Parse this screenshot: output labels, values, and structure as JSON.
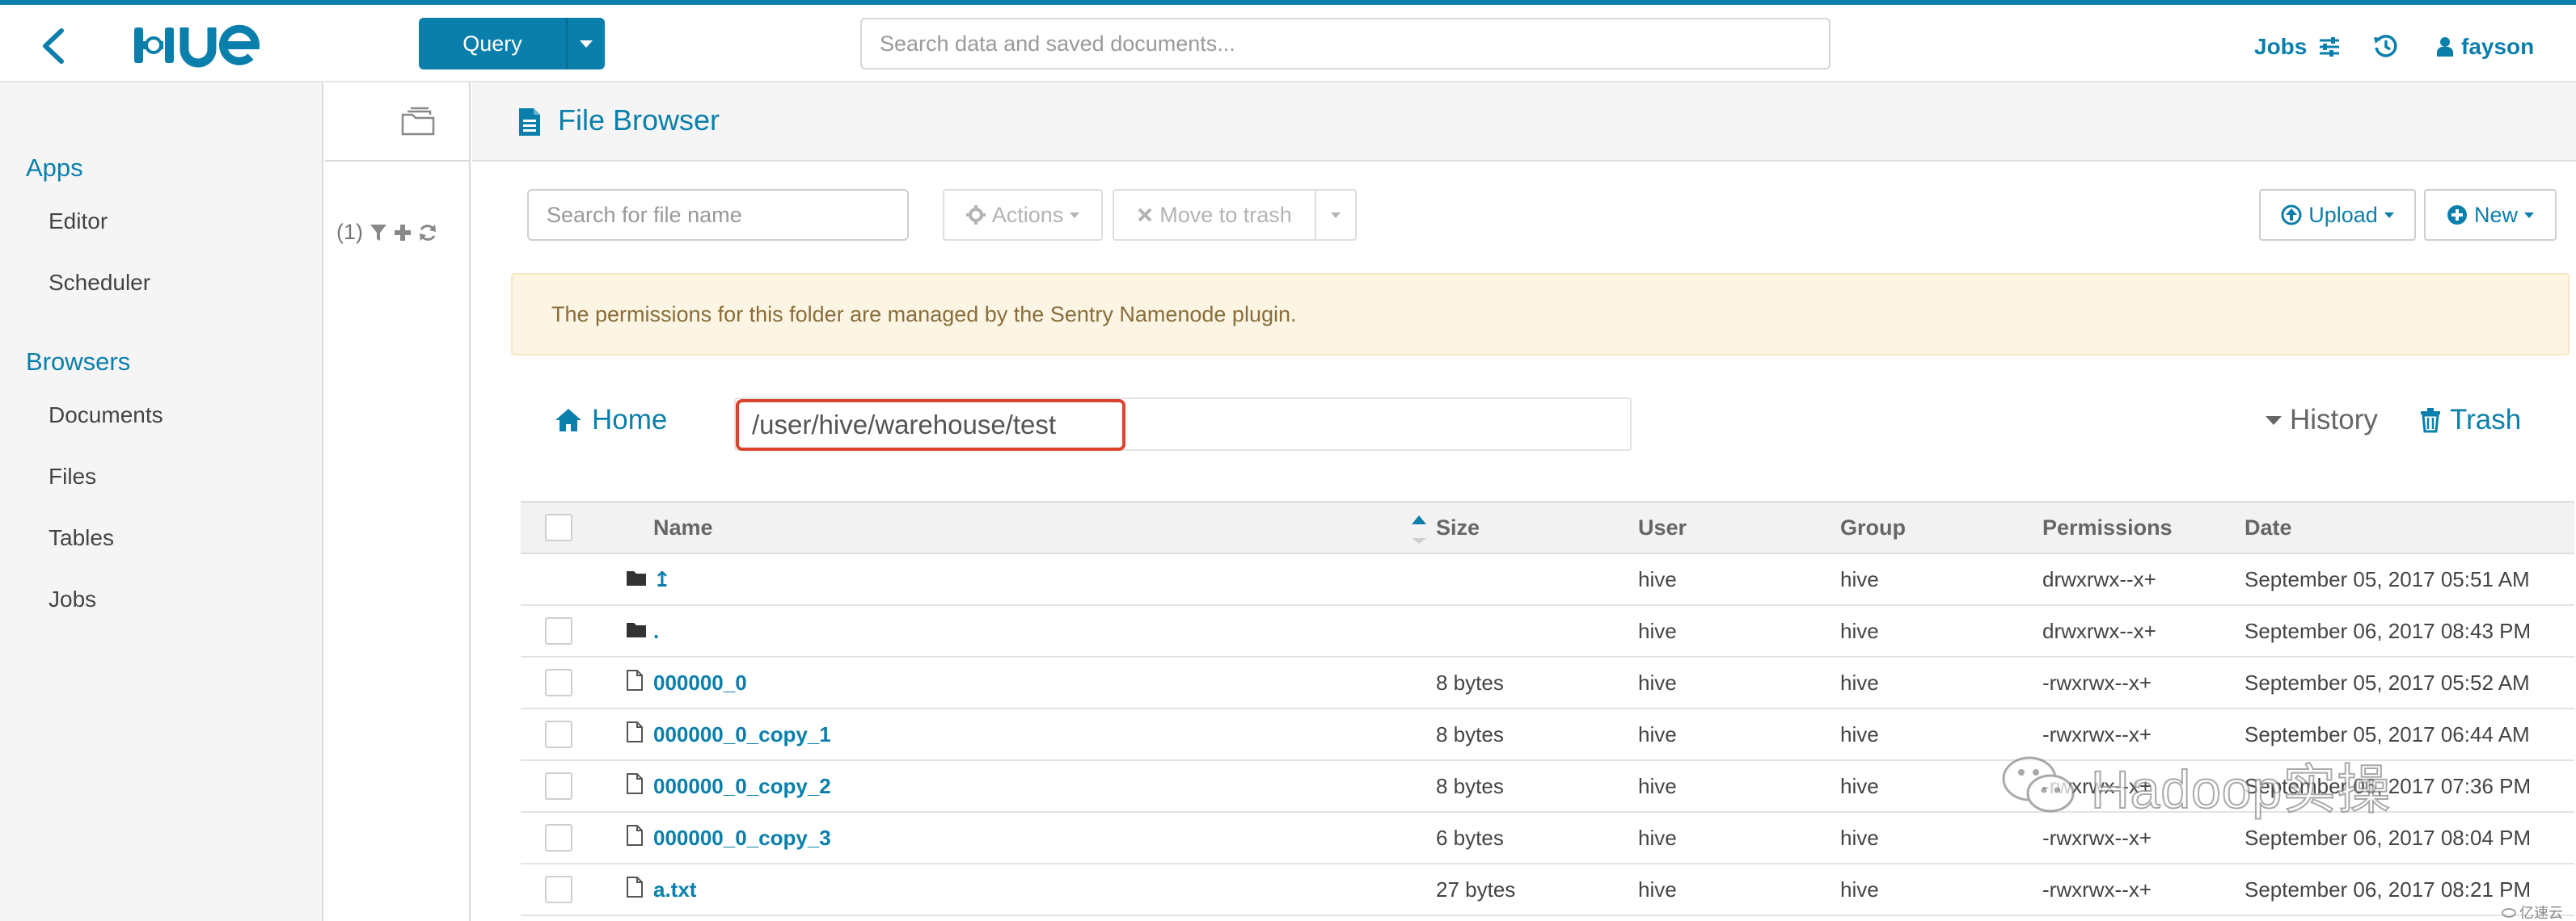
{
  "header": {
    "logo_text": "HUE",
    "query_label": "Query",
    "search_placeholder": "Search data and saved documents...",
    "jobs_label": "Jobs",
    "user_label": "fayson",
    "accent_color": "#0B7FAB"
  },
  "sidebar": {
    "sections": [
      {
        "label": "Apps",
        "items": [
          "Editor",
          "Scheduler"
        ]
      },
      {
        "label": "Browsers",
        "items": [
          "Documents",
          "Files",
          "Tables",
          "Jobs"
        ]
      }
    ]
  },
  "assist": {
    "filter_count": "(1)"
  },
  "main": {
    "title": "File Browser",
    "file_search_placeholder": "Search for file name",
    "actions_label": "Actions",
    "move_to_trash_label": "Move to trash",
    "upload_label": "Upload",
    "new_label": "New",
    "alert_text": "The permissions for this folder are managed by the Sentry Namenode plugin.",
    "home_label": "Home",
    "path_value": "/user/hive/warehouse/test",
    "history_label": "History",
    "trash_label": "Trash"
  },
  "table": {
    "columns": [
      "Name",
      "Size",
      "User",
      "Group",
      "Permissions",
      "Date"
    ],
    "rows": [
      {
        "type": "folder",
        "name": "↥",
        "size": "",
        "user": "hive",
        "group": "hive",
        "permissions": "drwxrwx--x+",
        "date": "September 05, 2017 05:51 AM",
        "checkbox": false
      },
      {
        "type": "folder",
        "name": ".",
        "size": "",
        "user": "hive",
        "group": "hive",
        "permissions": "drwxrwx--x+",
        "date": "September 06, 2017 08:43 PM",
        "checkbox": true
      },
      {
        "type": "file",
        "name": "000000_0",
        "size": "8 bytes",
        "user": "hive",
        "group": "hive",
        "permissions": "-rwxrwx--x+",
        "date": "September 05, 2017 05:52 AM",
        "checkbox": true
      },
      {
        "type": "file",
        "name": "000000_0_copy_1",
        "size": "8 bytes",
        "user": "hive",
        "group": "hive",
        "permissions": "-rwxrwx--x+",
        "date": "September 05, 2017 06:44 AM",
        "checkbox": true
      },
      {
        "type": "file",
        "name": "000000_0_copy_2",
        "size": "8 bytes",
        "user": "hive",
        "group": "hive",
        "permissions": "-rwxrwx--x+",
        "date": "September 06, 2017 07:36 PM",
        "checkbox": true
      },
      {
        "type": "file",
        "name": "000000_0_copy_3",
        "size": "6 bytes",
        "user": "hive",
        "group": "hive",
        "permissions": "-rwxrwx--x+",
        "date": "September 06, 2017 08:04 PM",
        "checkbox": true
      },
      {
        "type": "file",
        "name": "a.txt",
        "size": "27 bytes",
        "user": "hive",
        "group": "hive",
        "permissions": "-rwxrwx--x+",
        "date": "September 06, 2017 08:21 PM",
        "checkbox": true
      }
    ]
  },
  "watermark": {
    "text": "Hadoop实操",
    "corner_text": "亿速云"
  }
}
